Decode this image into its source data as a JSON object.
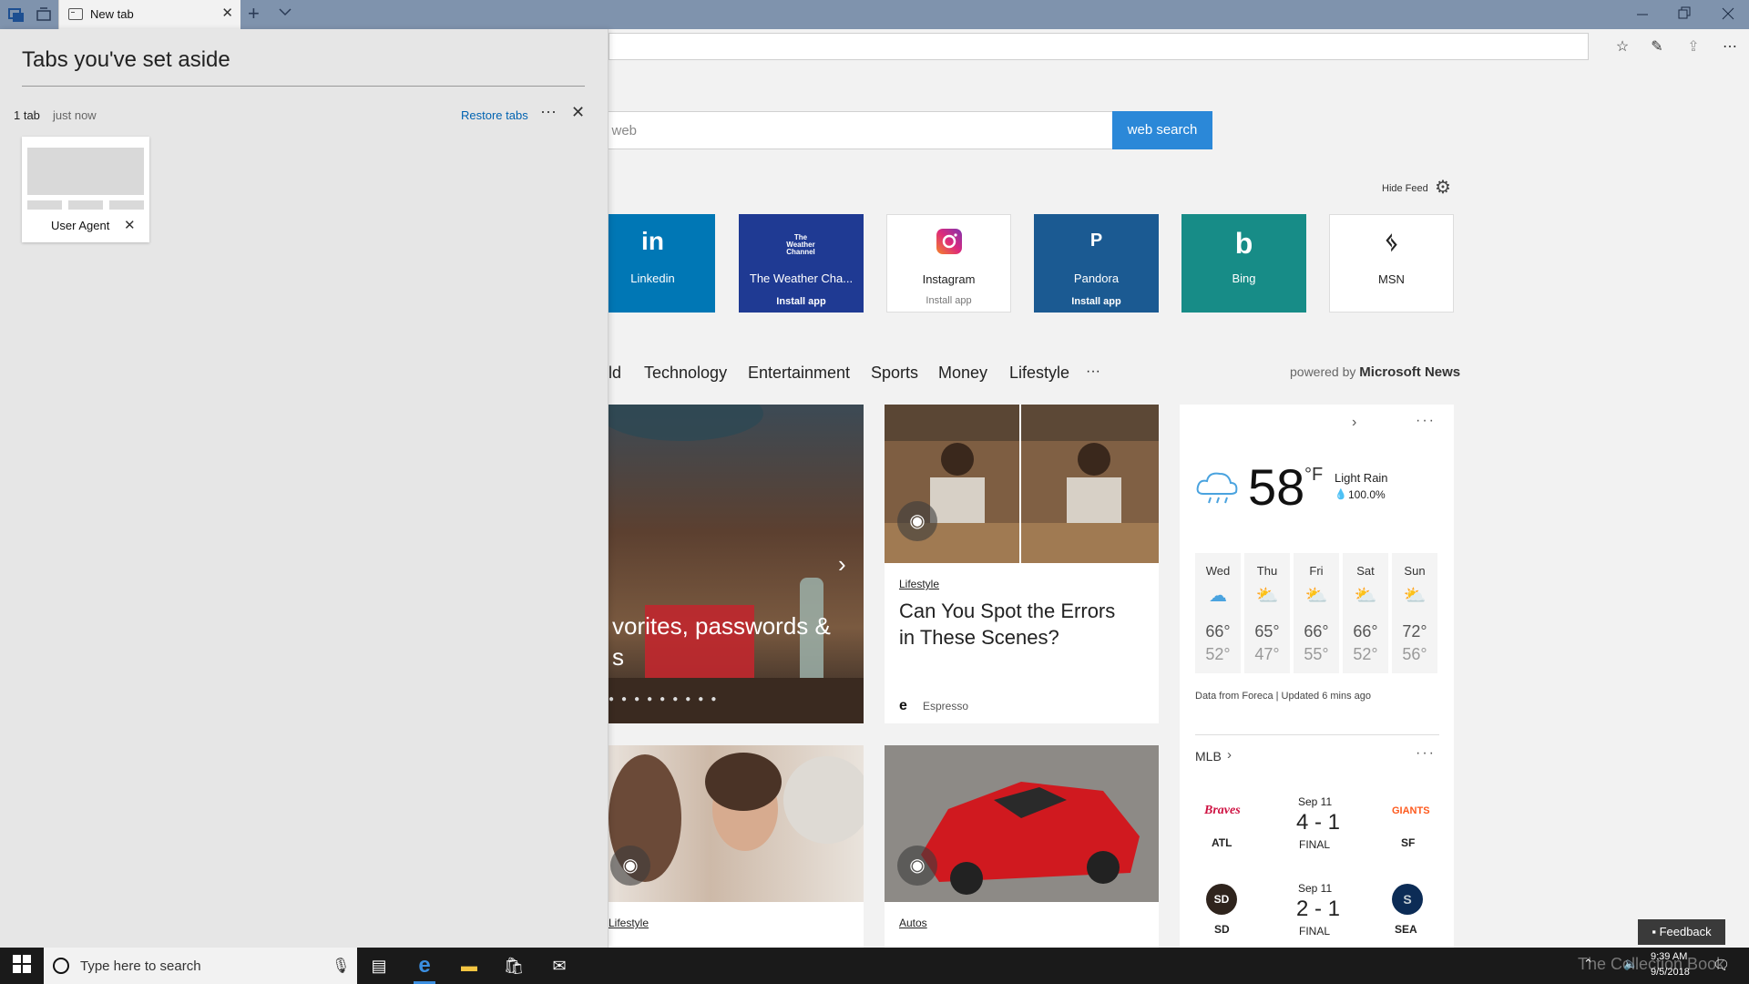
{
  "browser": {
    "tab_title": "New tab",
    "new_tab_symbol": "+",
    "close_symbol": "✕"
  },
  "aside_panel": {
    "title": "Tabs you've set aside",
    "count": "1 tab",
    "time": "just now",
    "restore_label": "Restore tabs",
    "more_label": "···",
    "close_symbol": "✕",
    "tab_label": "User Agent",
    "tab_close_symbol": "✕"
  },
  "search": {
    "placeholder": "e web",
    "button_label": "web search"
  },
  "feed_controls": {
    "hide_label": "Hide Feed"
  },
  "top_sites": [
    {
      "name": "Linkedin",
      "icon_text": "in",
      "install": "",
      "bg": "#0077b5",
      "fg": "#ffffff"
    },
    {
      "name": "The Weather Cha...",
      "icon_text": "The Weather Channel",
      "install": "Install app",
      "bg": "#1f3a93",
      "fg": "#ffffff"
    },
    {
      "name": "Instagram",
      "icon_text": "◎",
      "install": "Install app",
      "bg": "#ffffff",
      "fg": "#222222"
    },
    {
      "name": "Pandora",
      "icon_text": "P",
      "install": "Install app",
      "bg": "#1b5a92",
      "fg": "#ffffff"
    },
    {
      "name": "Bing",
      "icon_text": "b",
      "install": "",
      "bg": "#178c87",
      "fg": "#ffffff"
    },
    {
      "name": "MSN",
      "icon_text": "ᛃ",
      "install": "",
      "bg": "#ffffff",
      "fg": "#222222"
    }
  ],
  "news_nav": {
    "items": [
      "ld",
      "Technology",
      "Entertainment",
      "Sports",
      "Money",
      "Lifestyle",
      "···"
    ],
    "powered_prefix": "powered by",
    "powered_brand": "Microsoft News"
  },
  "hero_card": {
    "caption_line1": "vorites, passwords &",
    "caption_line2": "s"
  },
  "article_card": {
    "category": "Lifestyle",
    "headline": "Can You Spot the Errors in These Scenes?",
    "source": "Espresso"
  },
  "bottom_cards": [
    {
      "category": "Lifestyle"
    },
    {
      "category": "Autos"
    }
  ],
  "weather": {
    "temp": "58",
    "unit": "°F",
    "condition": "Light Rain",
    "precip": "100.0%",
    "days": [
      {
        "day": "Wed",
        "high": "66°",
        "low": "52°",
        "icon": "rain"
      },
      {
        "day": "Thu",
        "high": "65°",
        "low": "47°",
        "icon": "partly-sunny"
      },
      {
        "day": "Fri",
        "high": "66°",
        "low": "55°",
        "icon": "partly-sunny"
      },
      {
        "day": "Sat",
        "high": "66°",
        "low": "52°",
        "icon": "partly-sunny"
      },
      {
        "day": "Sun",
        "high": "72°",
        "low": "56°",
        "icon": "partly-sunny"
      }
    ],
    "footer": "Data from Foreca | Updated 6 mins ago"
  },
  "mlb": {
    "title": "MLB",
    "games": [
      {
        "date": "Sep 11",
        "score": "4 - 1",
        "status": "FINAL",
        "away": "ATL",
        "home": "SF",
        "away_logo": "Braves",
        "home_logo": "GIANTS"
      },
      {
        "date": "Sep 11",
        "score": "2 - 1",
        "status": "FINAL",
        "away": "SD",
        "home": "SEA",
        "away_logo": "SD",
        "home_logo": "S"
      }
    ]
  },
  "feedback_label": "Feedback",
  "taskbar": {
    "search_placeholder": "Type here to search",
    "time": "9:39 AM",
    "date": "9/5/2018",
    "watermark": "The Collection Book"
  }
}
